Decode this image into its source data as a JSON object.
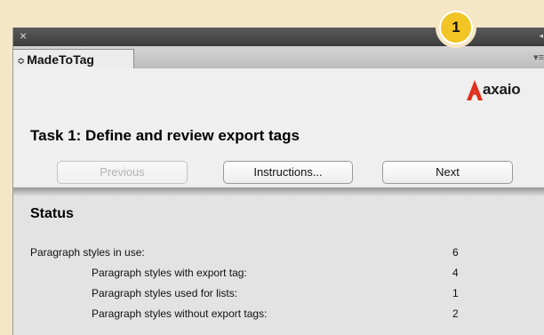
{
  "panel": {
    "title": "MadeToTag",
    "tab_grip_icon": "updown-grip-icon",
    "close_icon": "close-icon",
    "menu_icon": "panel-menu-icon"
  },
  "logo": {
    "text": "axaio",
    "accent_color": "#e0301e"
  },
  "task": {
    "title": "Task 1: Define and review export tags"
  },
  "buttons": {
    "previous": "Previous",
    "instructions": "Instructions...",
    "next": "Next"
  },
  "status": {
    "title": "Status",
    "rows": [
      {
        "label": "Paragraph styles in use:",
        "value": "6"
      },
      {
        "label": "Paragraph styles with export tag:",
        "value": "4"
      },
      {
        "label": "Paragraph styles used for lists:",
        "value": "1"
      },
      {
        "label": "Paragraph styles without export tags:",
        "value": "2"
      }
    ]
  },
  "callout": {
    "number": "1",
    "color": "#f2c524"
  }
}
